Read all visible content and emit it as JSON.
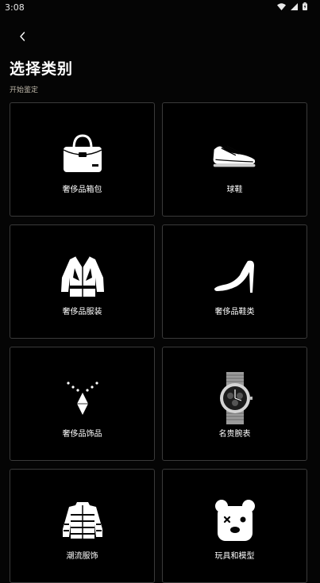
{
  "status_bar": {
    "time": "3:08"
  },
  "header": {
    "title": "选择类别",
    "subtitle": "开始鉴定"
  },
  "categories": [
    {
      "label": "奢侈品箱包",
      "icon": "handbag-icon"
    },
    {
      "label": "球鞋",
      "icon": "sneaker-icon"
    },
    {
      "label": "奢侈品服装",
      "icon": "jacket-icon"
    },
    {
      "label": "奢侈品鞋类",
      "icon": "high-heel-icon"
    },
    {
      "label": "奢侈品饰品",
      "icon": "necklace-icon"
    },
    {
      "label": "名贵腕表",
      "icon": "watch-icon"
    },
    {
      "label": "潮流服饰",
      "icon": "puffer-jacket-icon"
    },
    {
      "label": "玩具和模型",
      "icon": "bear-toy-icon"
    }
  ]
}
